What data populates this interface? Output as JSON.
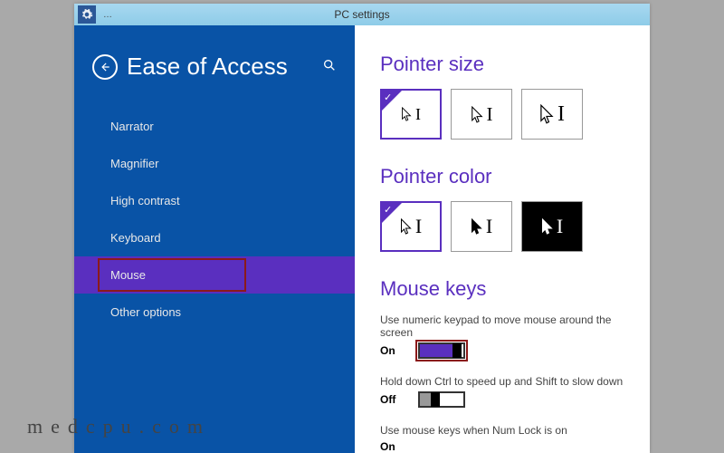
{
  "titlebar": {
    "app_icon": "gear-icon",
    "menu_dots": "…",
    "title": "PC settings"
  },
  "sidebar": {
    "back_icon": "back-arrow-icon",
    "heading": "Ease of Access",
    "search_icon": "search-icon",
    "items": [
      {
        "label": "Narrator",
        "selected": false
      },
      {
        "label": "Magnifier",
        "selected": false
      },
      {
        "label": "High contrast",
        "selected": false
      },
      {
        "label": "Keyboard",
        "selected": false
      },
      {
        "label": "Mouse",
        "selected": true
      },
      {
        "label": "Other options",
        "selected": false
      }
    ]
  },
  "main": {
    "pointer_size": {
      "title": "Pointer size",
      "options": [
        {
          "name": "pointer-size-small",
          "selected": true
        },
        {
          "name": "pointer-size-medium",
          "selected": false
        },
        {
          "name": "pointer-size-large",
          "selected": false
        }
      ]
    },
    "pointer_color": {
      "title": "Pointer color",
      "options": [
        {
          "name": "pointer-color-white",
          "selected": true,
          "bg": "white"
        },
        {
          "name": "pointer-color-black",
          "selected": false,
          "bg": "white"
        },
        {
          "name": "pointer-color-invert",
          "selected": false,
          "bg": "black"
        }
      ]
    },
    "mouse_keys": {
      "title": "Mouse keys",
      "settings": [
        {
          "label": "Use numeric keypad to move mouse around the screen",
          "state": "On",
          "on": true,
          "highlighted": true
        },
        {
          "label": "Hold down Ctrl to speed up and Shift to slow down",
          "state": "Off",
          "on": false,
          "highlighted": false
        },
        {
          "label": "Use mouse keys when Num Lock is on",
          "state": "On",
          "on": true,
          "highlighted": false
        }
      ]
    }
  },
  "watermark": "medcpu.com",
  "colors": {
    "accent": "#5a2fbf",
    "sidebar_bg": "#0953a6",
    "titlebar_bg": "#8ecce8",
    "highlight_border": "#8b1a1a"
  }
}
